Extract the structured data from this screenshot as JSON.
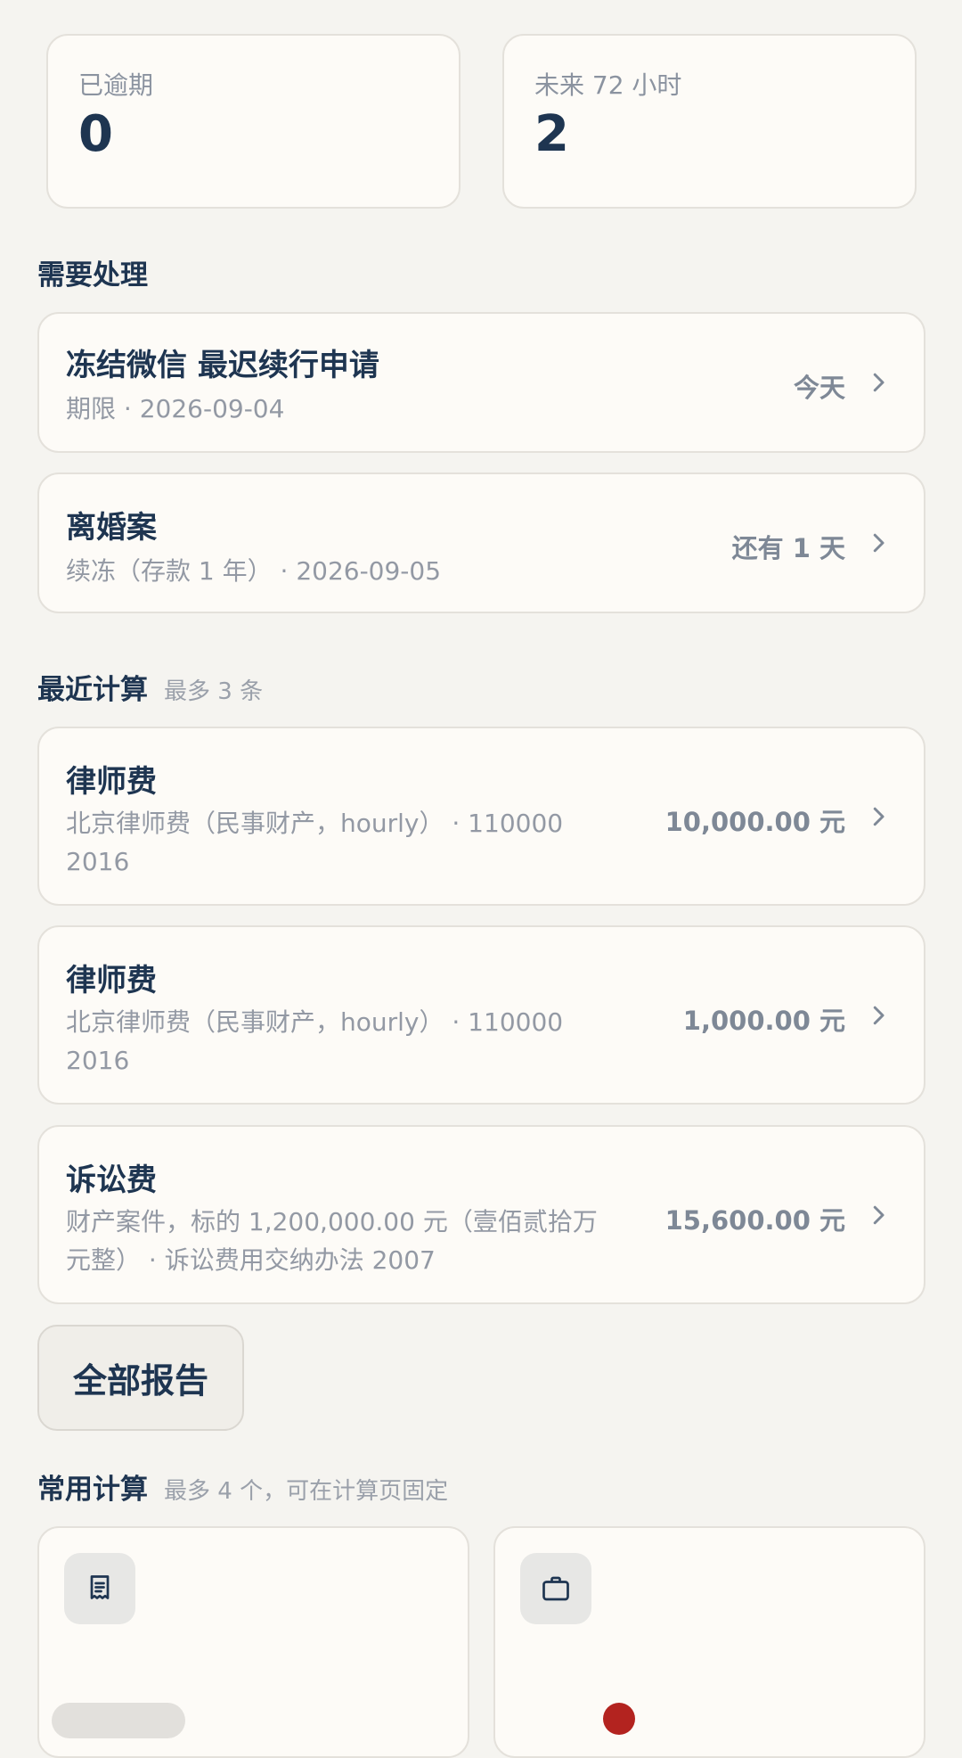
{
  "stats": {
    "overdue": {
      "label": "已逾期",
      "value": "0"
    },
    "next72": {
      "label": "未来 72 小时",
      "value": "2"
    }
  },
  "pending": {
    "title": "需要处理",
    "items": [
      {
        "title": "冻结微信 最迟续行申请",
        "subtitle": "期限 · 2026-09-04",
        "status": "今天"
      },
      {
        "title": "离婚案",
        "subtitle": "续冻（存款 1 年） · 2026-09-05",
        "status": "还有 1 天"
      }
    ]
  },
  "recent": {
    "title": "最近计算",
    "note": "最多 3 条",
    "items": [
      {
        "title": "律师费",
        "subtitle_line1": "北京律师费（民事财产，hourly） · 110000",
        "subtitle_line2": "2016",
        "amount": "10,000.00 元"
      },
      {
        "title": "律师费",
        "subtitle_line1": "北京律师费（民事财产，hourly） · 110000",
        "subtitle_line2": "2016",
        "amount": "1,000.00 元"
      },
      {
        "title": "诉讼费",
        "subtitle_line1": "财产案件，标的 1,200,000.00 元（壹佰贰拾万",
        "subtitle_line2": "元整） · 诉讼费用交纳办法 2007",
        "amount": "15,600.00 元"
      }
    ],
    "all_reports_label": "全部报告"
  },
  "favorites": {
    "title": "常用计算",
    "note": "最多 4 个，可在计算页固定",
    "tiles": [
      {
        "icon": "receipt-icon"
      },
      {
        "icon": "briefcase-icon"
      }
    ]
  },
  "colors": {
    "background": "#f5f4f0",
    "card": "#fdfbf7",
    "primary_text": "#1e3551",
    "muted_text": "#9399a4",
    "accent_red": "#b3231f"
  }
}
